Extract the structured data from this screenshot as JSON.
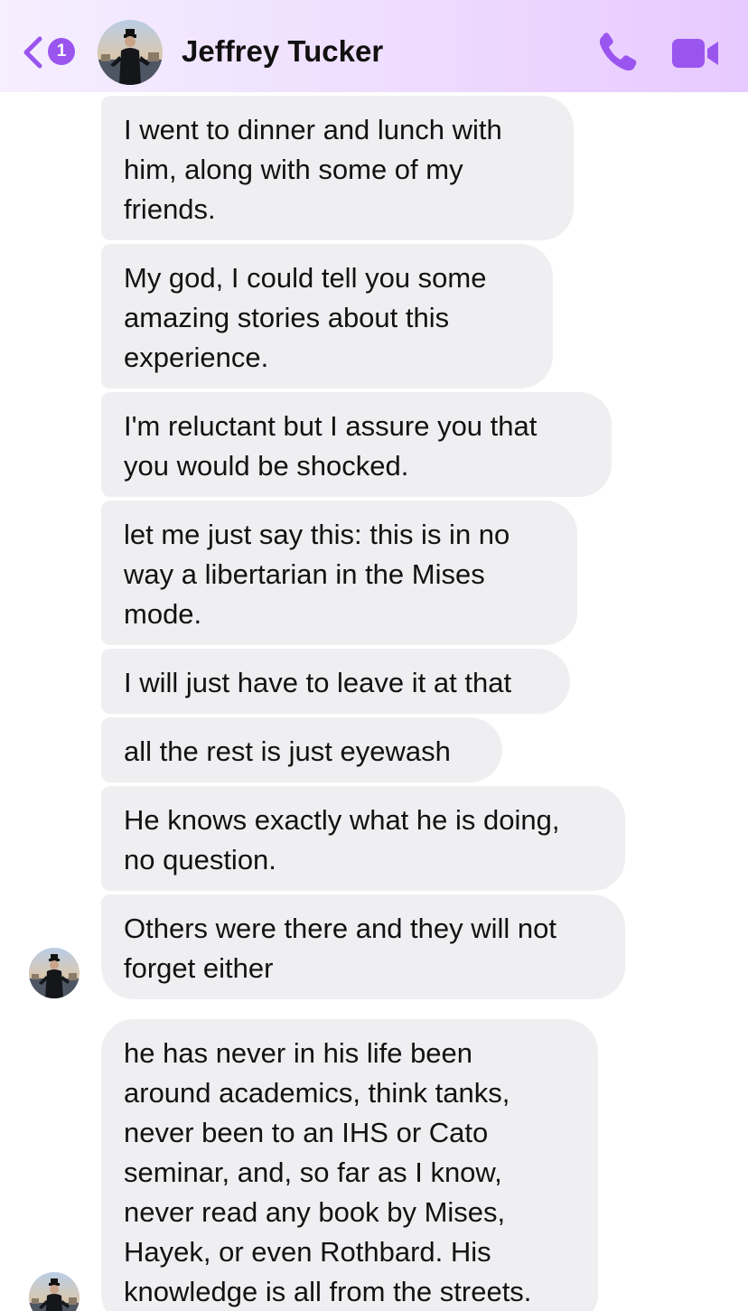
{
  "header": {
    "unread_count": "1",
    "contact_name": "Jeffrey Tucker",
    "icons": {
      "back": "chevron-left-icon",
      "call": "phone-icon",
      "video": "video-camera-icon"
    },
    "accent_color": "#9b55ef"
  },
  "messages": [
    {
      "text": "I went to dinner and lunch with\nhim, along with some of my\nfriends."
    },
    {
      "text": "My god, I could tell you some\namazing stories about this\nexperience."
    },
    {
      "text": "I'm reluctant but I assure you that\nyou would be shocked."
    },
    {
      "text": "let me just say this: this is in no\nway a libertarian in the Mises\nmode."
    },
    {
      "text": "I will just have to leave it at that"
    },
    {
      "text": "all the rest is just eyewash"
    },
    {
      "text": "He knows exactly what he is doing,\nno question."
    },
    {
      "text": "Others were there and they will not\nforget either"
    },
    {
      "text": "he has never in his life been\naround academics, think tanks,\nnever been to an IHS or Cato\nseminar, and, so far as I know,\nnever read any book by Mises,\nHayek, or even Rothbard. His\nknowledge is all from the streets."
    }
  ],
  "bubble_color": "#efeff1"
}
